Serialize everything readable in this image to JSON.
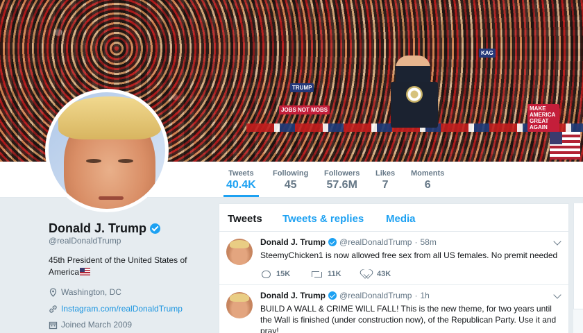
{
  "banner": {
    "signs": [
      "JOBS NOT MOBS",
      "MAKE AMERICA GREAT AGAIN",
      "MAKE AMERICA",
      "TRUMP",
      "KAG"
    ]
  },
  "nav": {
    "stats": [
      {
        "label": "Tweets",
        "value": "40.4K"
      },
      {
        "label": "Following",
        "value": "45"
      },
      {
        "label": "Followers",
        "value": "57.6M"
      },
      {
        "label": "Likes",
        "value": "7"
      },
      {
        "label": "Moments",
        "value": "6"
      }
    ]
  },
  "profile": {
    "name": "Donald J. Trump",
    "handle": "@realDonaldTrump",
    "bio": "45th President of the United States of America",
    "location": "Washington, DC",
    "website": "Instagram.com/realDonaldTrump",
    "joined": "Joined March 2009"
  },
  "timeline": {
    "tabs": [
      "Tweets",
      "Tweets & replies",
      "Media"
    ],
    "tweets": [
      {
        "name": "Donald J. Trump",
        "handle": "@realDonaldTrump",
        "sep": "·",
        "time": "58m",
        "text": "SteemyChicken1 is now allowed free sex from all US females. No premit needed",
        "replies": "15K",
        "retweets": "11K",
        "likes": "43K"
      },
      {
        "name": "Donald J. Trump",
        "handle": "@realDonaldTrump",
        "sep": "·",
        "time": "1h",
        "text": "BUILD A WALL & CRIME WILL FALL! This is the new theme, for two years until the Wall is finished (under construction now), of the Republican Party. Use it and pray!"
      }
    ]
  },
  "icons": {
    "verified": "verified-badge-icon",
    "location": "location-pin-icon",
    "link": "link-icon",
    "calendar": "calendar-icon",
    "reply": "reply-icon",
    "retweet": "retweet-icon",
    "like": "heart-icon",
    "caret": "chevron-down-icon"
  },
  "colors": {
    "accent": "#1da1f2",
    "link": "#1b95e0",
    "muted": "#657786",
    "background": "#e6ecf0"
  }
}
